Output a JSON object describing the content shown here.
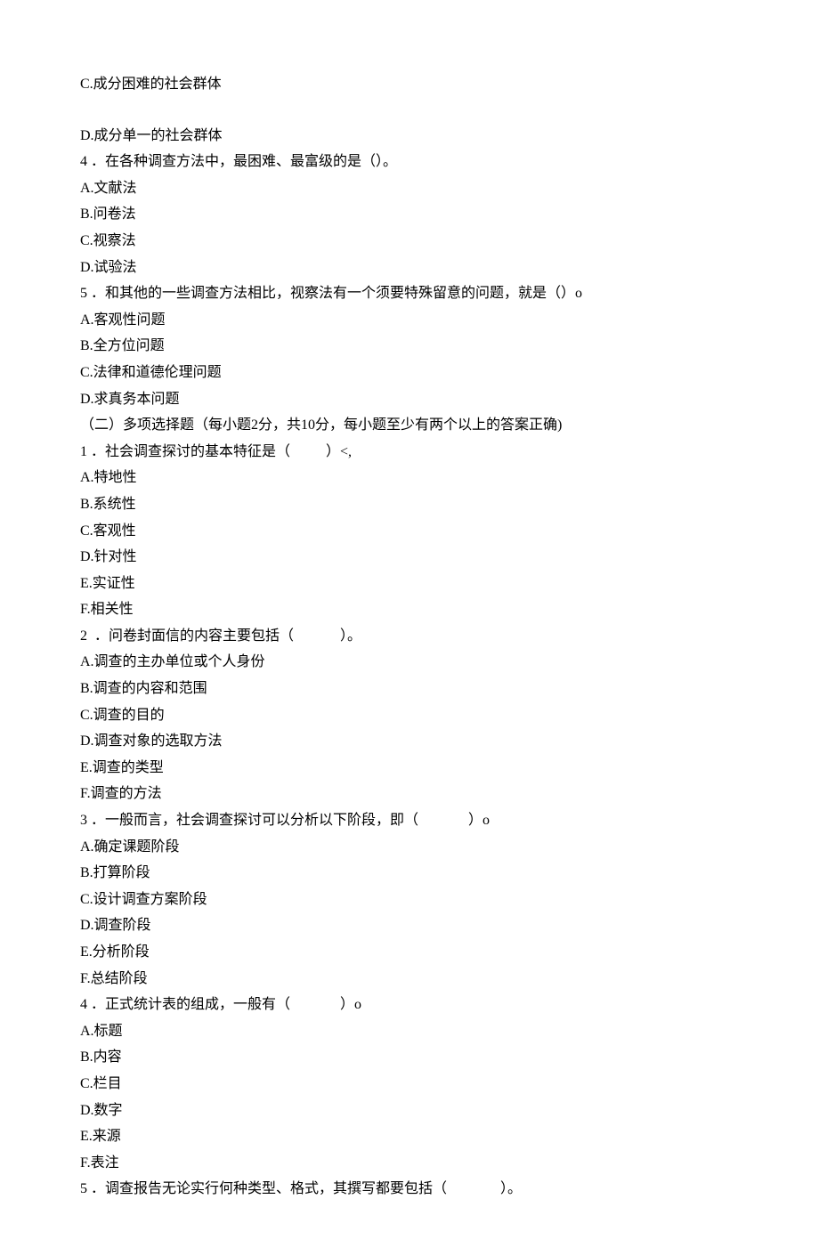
{
  "lines": [
    "C.成分困难的社会群体",
    "",
    "D.成分单一的社会群体",
    "4 ．在各种调查方法中，最困难、最富级的是（）。",
    "A.文献法",
    "B.问卷法",
    "C.视察法",
    "D.试验法",
    "5 ．和其他的一些调查方法相比，视察法有一个须要特殊留意的问题，就是（）o",
    "A.客观性问题",
    "B.全方位问题",
    "C.法律和道德伦理问题",
    "D.求真务本问题",
    "（二）多项选择题（每小题2分，共10分，每小题至少有两个以上的答案正确)",
    "1 ．社会调查探讨的基本特征是（          ）<,",
    "A.特地性",
    "B.系统性",
    "C.客观性",
    "D.针对性",
    "E.实证性",
    "F.相关性",
    "2  ．问卷封面信的内容主要包括（             ）。",
    "A.调查的主办单位或个人身份",
    "B.调查的内容和范围",
    "C.调查的目的",
    "D.调查对象的选取方法",
    "E.调查的类型",
    "F.调查的方法",
    "3 ．一般而言，社会调查探讨可以分析以下阶段，即（              ）o",
    "A.确定课题阶段",
    "B.打算阶段",
    "C.设计调查方案阶段",
    "D.调查阶段",
    "E.分析阶段",
    "F.总结阶段",
    "4 ．正式统计表的组成，一般有（              ）o",
    "A.标题",
    "B.内容",
    "C.栏目",
    "D.数字",
    "E.来源",
    "F.表注",
    "5 ．调查报告无论实行何种类型、格式，其撰写都要包括（               ）。"
  ]
}
